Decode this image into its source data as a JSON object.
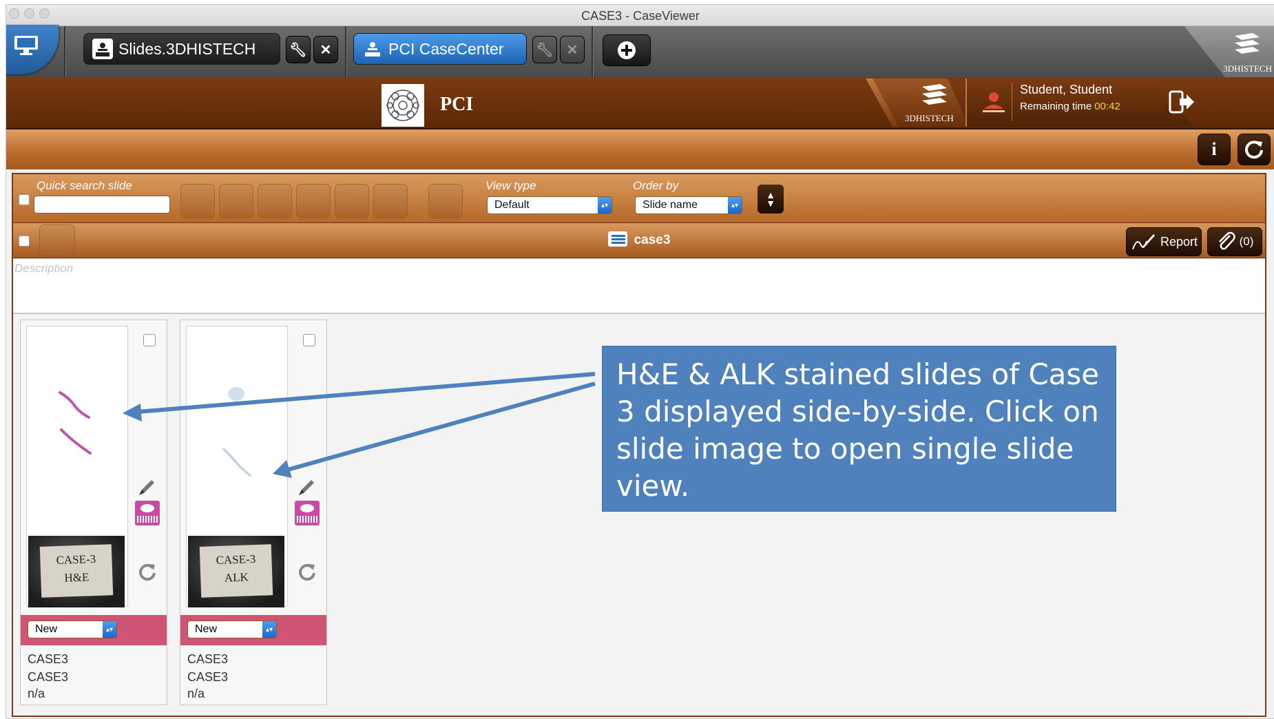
{
  "window": {
    "title": "CASE3 - CaseViewer"
  },
  "app_tabs": [
    {
      "label": "Slides.3DHISTECH"
    },
    {
      "label": "PCI CaseCenter"
    }
  ],
  "brand": {
    "name": "3DHISTECH"
  },
  "header": {
    "org": "PCI",
    "user_name": "Student, Student",
    "remaining_label": "Remaining time",
    "remaining_time": "00:42",
    "time_color": "#f3d43b"
  },
  "toolbar": {
    "quick_search_label": "Quick search slide",
    "quick_search_value": "",
    "view_type_label": "View type",
    "view_type_value": "Default",
    "order_by_label": "Order by",
    "order_by_value": "Slide name"
  },
  "case": {
    "title": "case3",
    "report_label": "Report",
    "attachments_label": "(0)",
    "description_placeholder": "Description"
  },
  "slides": [
    {
      "label_line1": "CASE-3",
      "label_line2": "H&E",
      "status": "New",
      "meta": [
        "CASE3",
        "CASE3",
        "n/a"
      ]
    },
    {
      "label_line1": "CASE-3",
      "label_line2": "ALK",
      "status": "New",
      "meta": [
        "CASE3",
        "CASE3",
        "n/a"
      ]
    }
  ],
  "callout": {
    "text": "H&E & ALK stained slides of Case 3 displayed side-by-side. Click on slide image to open single slide view."
  },
  "colors": {
    "brown": "#6a300a",
    "orange": "#b86a2a",
    "status_pink": "#d05575",
    "callout_blue": "#4f81bd",
    "accent_blue": "#1e64b4"
  }
}
